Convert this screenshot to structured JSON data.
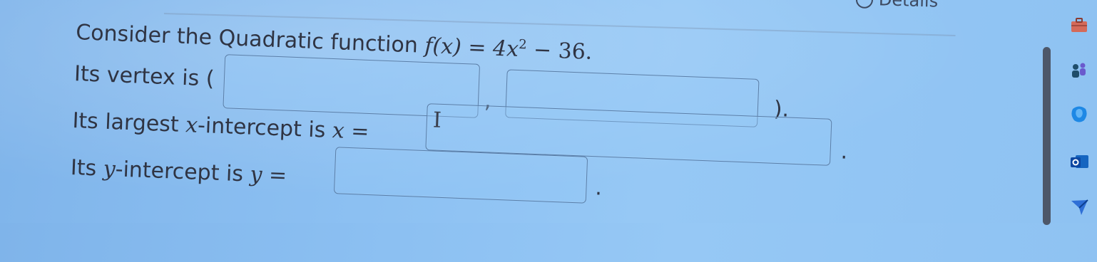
{
  "header": {
    "details_link": "Details"
  },
  "question": {
    "prompt": "Consider the Quadratic function",
    "function_lhs": "f(x)",
    "equals": "=",
    "function_rhs_coef": "4x",
    "function_rhs_power": "2",
    "function_rhs_tail": "− 36.",
    "vertex_label": "Its vertex is (",
    "vertex_separator": ",",
    "vertex_close": ").",
    "largest_x_prefix": "Its largest",
    "largest_x_var": "x",
    "largest_x_middle": "-intercept is",
    "largest_x_eq": "x =",
    "largest_x_cursor": "I",
    "largest_x_period": ".",
    "y_prefix": "Its",
    "y_var": "y",
    "y_middle": "-intercept is",
    "y_eq": "y =",
    "y_period": "."
  },
  "inputs": {
    "vertex_x": "",
    "vertex_y": "",
    "largest_x_intercept": "",
    "y_intercept": ""
  },
  "sidebar": {
    "icons": [
      "briefcase-icon",
      "people-icon",
      "copilot-icon",
      "outlook-icon",
      "send-icon"
    ]
  }
}
